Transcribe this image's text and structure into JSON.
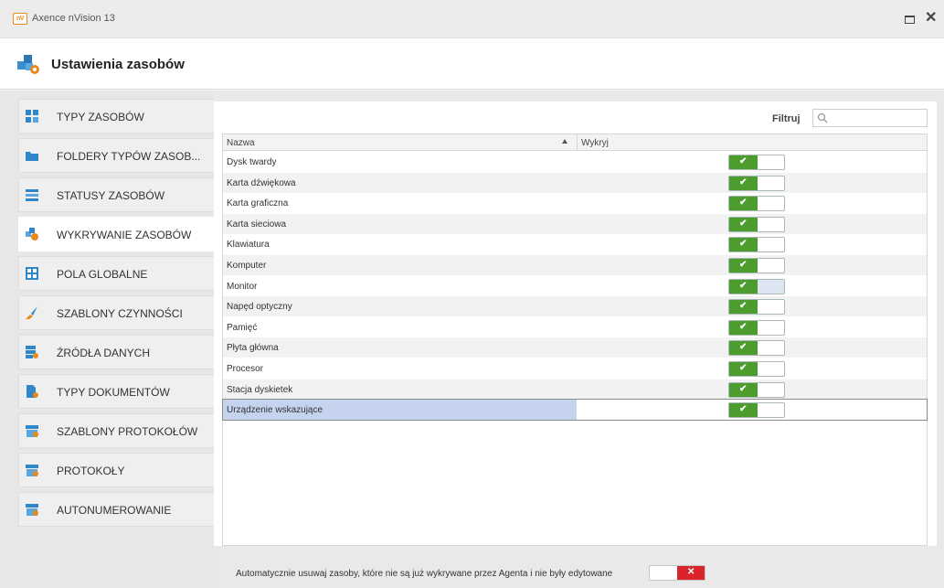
{
  "window": {
    "app_title": "Axence nVision 13",
    "logo_text": "nV",
    "close_glyph": "✕"
  },
  "header": {
    "title": "Ustawienia zasobów",
    "icon": "asset-settings-icon"
  },
  "sidebar": {
    "items": [
      {
        "label": "TYPY ZASOBÓW",
        "icon": "asset-types-icon",
        "color": "#2f86c9"
      },
      {
        "label": "FOLDERY TYPÓW ZASOB...",
        "icon": "folder-icon",
        "color": "#2f86c9"
      },
      {
        "label": "STATUSY ZASOBÓW",
        "icon": "status-list-icon",
        "color": "#2f86c9"
      },
      {
        "label": "WYKRYWANIE ZASOBÓW",
        "icon": "asset-detection-icon",
        "color": "#e8891b",
        "active": true
      },
      {
        "label": "POLA GLOBALNE",
        "icon": "global-fields-icon",
        "color": "#2f86c9"
      },
      {
        "label": "SZABLONY CZYNNOŚCI",
        "icon": "brush-icon",
        "color": "#e8891b"
      },
      {
        "label": "ŹRÓDŁA DANYCH",
        "icon": "data-source-icon",
        "color": "#2f86c9"
      },
      {
        "label": "TYPY DOKUMENTÓW",
        "icon": "document-types-icon",
        "color": "#2f86c9"
      },
      {
        "label": "SZABLONY PROTOKOŁÓW",
        "icon": "protocol-templates-icon",
        "color": "#2f86c9"
      },
      {
        "label": "PROTOKOŁY",
        "icon": "protocols-icon",
        "color": "#2f86c9"
      },
      {
        "label": "AUTONUMEROWANIE",
        "icon": "auto-numbering-icon",
        "color": "#2f86c9"
      }
    ]
  },
  "filter": {
    "label": "Filtruj",
    "value": "",
    "placeholder": ""
  },
  "grid": {
    "columns": [
      "Nazwa",
      "Wykryj"
    ],
    "sort": "ascending",
    "rows": [
      {
        "name": "Dysk twardy",
        "detect": true
      },
      {
        "name": "Karta dźwiękowa",
        "detect": true
      },
      {
        "name": "Karta graficzna",
        "detect": true
      },
      {
        "name": "Karta sieciowa",
        "detect": true
      },
      {
        "name": "Klawiatura",
        "detect": true
      },
      {
        "name": "Komputer",
        "detect": true
      },
      {
        "name": "Monitor",
        "detect": true
      },
      {
        "name": "Napęd optyczny",
        "detect": true
      },
      {
        "name": "Pamięć",
        "detect": true
      },
      {
        "name": "Płyta główna",
        "detect": true
      },
      {
        "name": "Procesor",
        "detect": true
      },
      {
        "name": "Stacja dyskietek",
        "detect": true
      },
      {
        "name": "Urządzenie wskazujące",
        "detect": true
      }
    ],
    "selected_row": "Urządzenie wskazujące",
    "hover_row": "Monitor",
    "toggle_on_glyph": "✔",
    "toggle_on_color": "#4c9c2e"
  },
  "footer": {
    "auto_remove_label": "Automatycznie usuwaj zasoby, które nie są już wykrywane przez Agenta i nie były edytowane",
    "auto_remove_enabled": false,
    "toggle_off_glyph": "✕",
    "toggle_off_color": "#d9242b"
  }
}
